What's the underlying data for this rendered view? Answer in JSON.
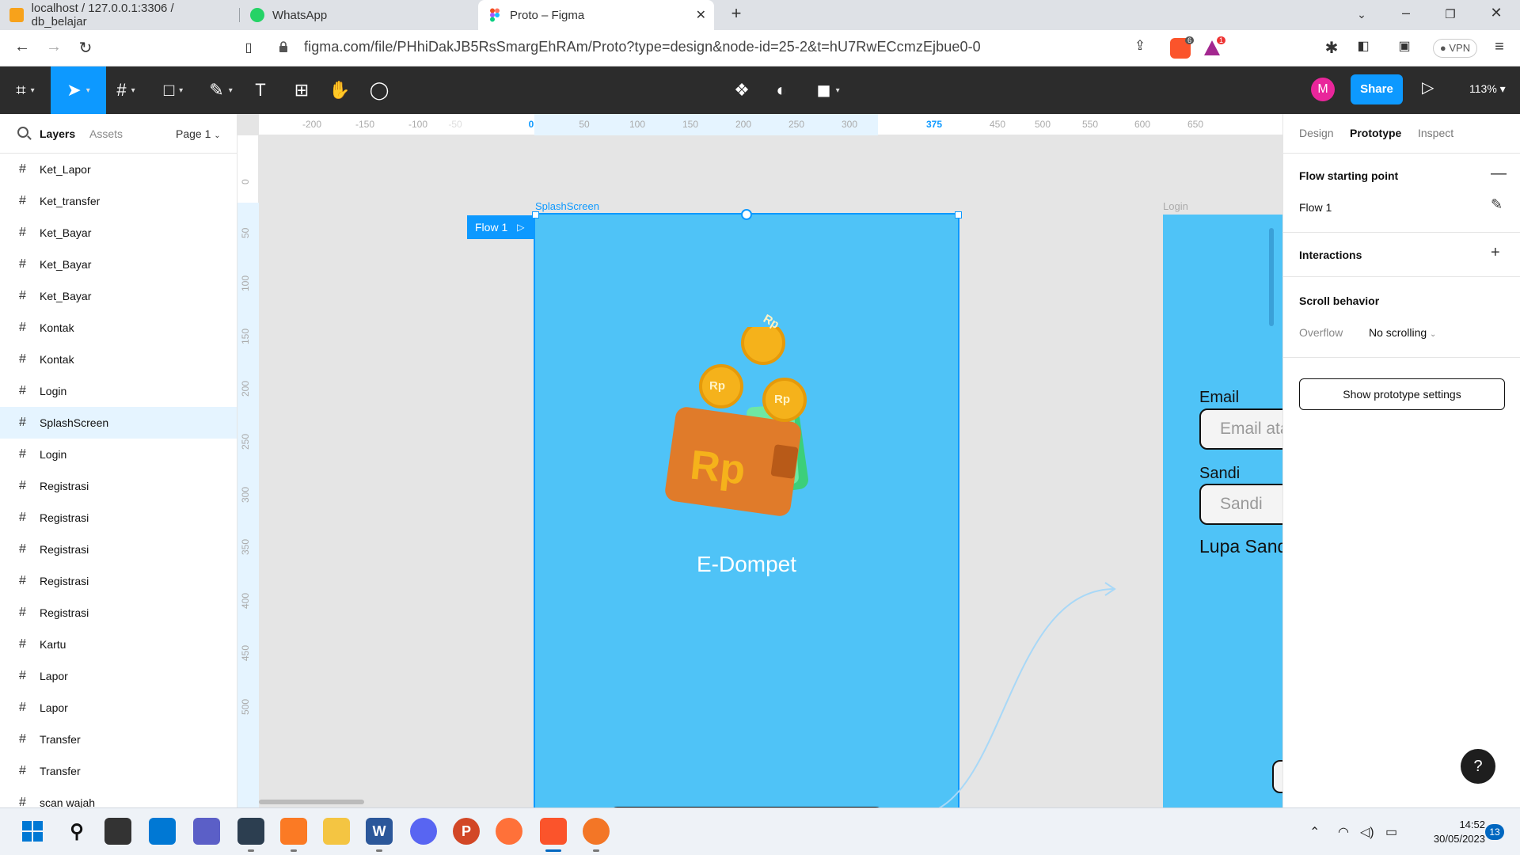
{
  "browser": {
    "tabs": [
      {
        "title": "localhost / 127.0.0.1:3306 / db_belajar"
      },
      {
        "title": "WhatsApp"
      },
      {
        "title": "Proto – Figma"
      }
    ],
    "new_tab_symbol": "+",
    "url": "figma.com/file/PHhiDakJB5RsSmargEhRAm/Proto?type=design&node-id=25-2&t=hU7RwECcmzEjbue0-0",
    "vpn_label": "VPN",
    "brave_badge": "6",
    "alert_badge": "1"
  },
  "figma_toolbar": {
    "avatar_initial": "M",
    "share_label": "Share",
    "zoom_label": "113%"
  },
  "left_panel": {
    "tabs": {
      "layers": "Layers",
      "assets": "Assets"
    },
    "page_selector": "Page 1",
    "layers": [
      {
        "name": "Ket_Lapor",
        "selected": false
      },
      {
        "name": "Ket_transfer",
        "selected": false
      },
      {
        "name": "Ket_Bayar",
        "selected": false
      },
      {
        "name": "Ket_Bayar",
        "selected": false
      },
      {
        "name": "Ket_Bayar",
        "selected": false
      },
      {
        "name": "Kontak",
        "selected": false
      },
      {
        "name": "Kontak",
        "selected": false
      },
      {
        "name": "Login",
        "selected": false
      },
      {
        "name": "SplashScreen",
        "selected": true
      },
      {
        "name": "Login",
        "selected": false
      },
      {
        "name": "Registrasi",
        "selected": false
      },
      {
        "name": "Registrasi",
        "selected": false
      },
      {
        "name": "Registrasi",
        "selected": false
      },
      {
        "name": "Registrasi",
        "selected": false
      },
      {
        "name": "Registrasi",
        "selected": false
      },
      {
        "name": "Kartu",
        "selected": false
      },
      {
        "name": "Lapor",
        "selected": false
      },
      {
        "name": "Lapor",
        "selected": false
      },
      {
        "name": "Transfer",
        "selected": false
      },
      {
        "name": "Transfer",
        "selected": false
      },
      {
        "name": "scan wajah",
        "selected": false
      }
    ]
  },
  "canvas": {
    "ruler_top": [
      "-200",
      "-150",
      "-100",
      "-50",
      "0",
      "50",
      "100",
      "150",
      "200",
      "250",
      "300",
      "375",
      "450",
      "500",
      "550",
      "600",
      "650"
    ],
    "ruler_left": [
      "0",
      "50",
      "100",
      "150",
      "200",
      "250",
      "300",
      "350",
      "400",
      "450",
      "500"
    ],
    "splash_frame_name": "SplashScreen",
    "flow_tag": "Flow 1",
    "app_title": "E-Dompet",
    "wallet_text": "Rp",
    "coin_text": "Rp",
    "login_frame_name": "Login",
    "login": {
      "email_label": "Email",
      "email_placeholder": "Email ata",
      "password_label": "Sandi",
      "password_placeholder": "Sandi",
      "forgot_label": "Lupa Sand"
    },
    "colors": {
      "frame_bg": "#4fc3f7",
      "selection": "#0d99ff"
    }
  },
  "right_panel": {
    "tabs": {
      "design": "Design",
      "prototype": "Prototype",
      "inspect": "Inspect"
    },
    "flow_section_title": "Flow starting point",
    "flow_name": "Flow 1",
    "interactions_title": "Interactions",
    "scroll_title": "Scroll behavior",
    "overflow_label": "Overflow",
    "overflow_value": "No scrolling",
    "settings_button": "Show prototype settings",
    "help_label": "?"
  },
  "taskbar": {
    "time": "14:52",
    "date": "30/05/2023",
    "notification_count": "13"
  }
}
